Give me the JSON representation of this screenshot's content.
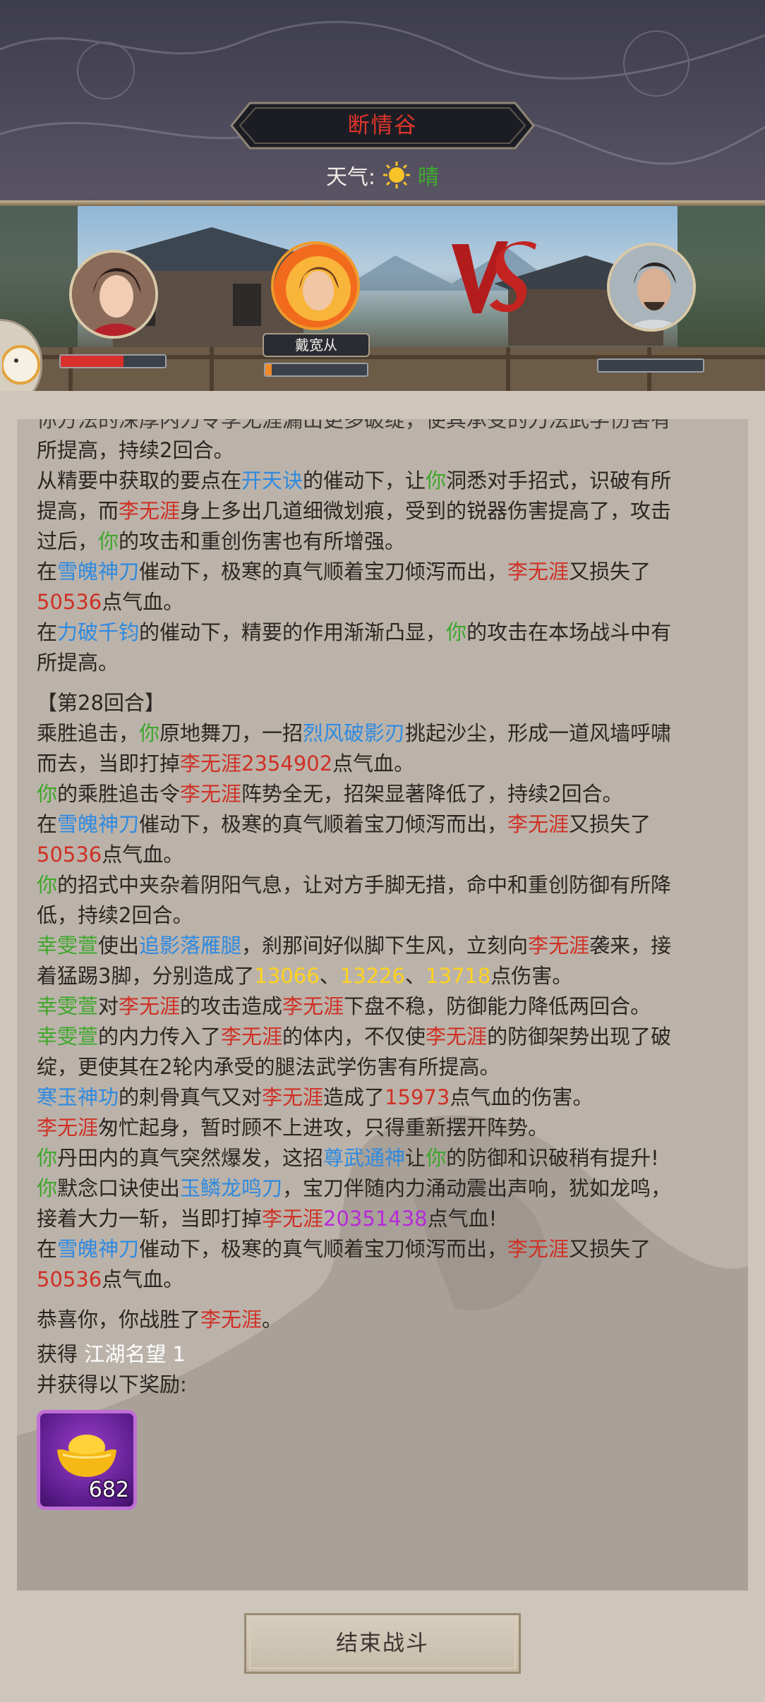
{
  "header": {
    "location": "断情谷",
    "weather_label": "天气:",
    "weather_value": "晴"
  },
  "battle": {
    "player_name_tag": "戴宽从",
    "player_hp_fraction": 0.6,
    "ally_hp_fraction": 0.06,
    "enemy_hp_fraction": 0.0
  },
  "log": {
    "l00": "你方法的深厚内力令李无涯漏出更多破绽，使其承受的刀法武学伤害有",
    "l01": "所提高，持续2回合。",
    "l02a": "从精要中获取的要点在",
    "l02b": "开天诀",
    "l02c": "的催动下，让",
    "l02d": "你",
    "l02e": "洞悉对手招式，识破有所",
    "l03a": "提高，而",
    "l03b": "李无涯",
    "l03c": "身上多出几道细微划痕，受到的锐器伤害提高了，攻击",
    "l04a": "过后，",
    "l04b": "你",
    "l04c": "的攻击和重创伤害也有所增强。",
    "l05a": "在",
    "l05b": "雪魄神刀",
    "l05c": "催动下，极寒的真气顺着宝刀倾泻而出，",
    "l05d": "李无涯",
    "l05e": "又损失了",
    "l06a": "50536",
    "l06b": "点气血。",
    "l07a": "在",
    "l07b": "力破千钧",
    "l07c": "的催动下，精要的作用渐渐凸显，",
    "l07d": "你",
    "l07e": "的攻击在本场战斗中有",
    "l08": "所提高。",
    "round": "【第28回合】",
    "l10a": "乘胜追击，",
    "l10b": "你",
    "l10c": "原地舞刀，一招",
    "l10d": "烈风破影刃",
    "l10e": "挑起沙尘，形成一道风墙呼啸",
    "l11a": "而去，当即打掉",
    "l11b": "李无涯2354902",
    "l11c": "点气血。",
    "l12a": "你",
    "l12b": "的乘胜追击令",
    "l12c": "李无涯",
    "l12d": "阵势全无，招架显著降低了，持续2回合。",
    "l13a": "在",
    "l13b": "雪魄神刀",
    "l13c": "催动下，极寒的真气顺着宝刀倾泻而出，",
    "l13d": "李无涯",
    "l13e": "又损失了",
    "l14a": "50536",
    "l14b": "点气血。",
    "l15a": "你",
    "l15b": "的招式中夹杂着阴阳气息，让对方手脚无措，命中和重创防御有所降",
    "l16": "低，持续2回合。",
    "l17a": "幸雯萱",
    "l17b": "使出",
    "l17c": "追影落雁腿",
    "l17d": "，刹那间好似脚下生风，立刻向",
    "l17e": "李无涯",
    "l17f": "袭来，接",
    "l18a": "着猛踢3脚，分别造成了",
    "l18b": "13066",
    "l18c": "、",
    "l18d": "13226",
    "l18e": "、",
    "l18f": "13718",
    "l18g": "点伤害。",
    "l19a": "幸雯萱",
    "l19b": "对",
    "l19c": "李无涯",
    "l19d": "的攻击造成",
    "l19e": "李无涯",
    "l19f": "下盘不稳，防御能力降低两回合。",
    "l20a": "幸雯萱",
    "l20b": "的内力传入了",
    "l20c": "李无涯",
    "l20d": "的体内，不仅使",
    "l20e": "李无涯",
    "l20f": "的防御架势出现了破",
    "l21": "绽，更使其在2轮内承受的腿法武学伤害有所提高。",
    "l22a": "寒玉神功",
    "l22b": "的刺骨真气又对",
    "l22c": "李无涯",
    "l22d": "造成了",
    "l22e": "15973",
    "l22f": "点气血的伤害。",
    "l23a": "李无涯",
    "l23b": "匆忙起身，暂时顾不上进攻，只得重新摆开阵势。",
    "l24a": "你",
    "l24b": "丹田内的真气突然爆发，这招",
    "l24c": "尊武通神",
    "l24d": "让",
    "l24e": "你",
    "l24f": "的防御和识破稍有提升!",
    "l25a": "你",
    "l25b": "默念口诀使出",
    "l25c": "玉鳞龙鸣刀",
    "l25d": "，宝刀伴随内力涌动震出声响，犹如龙鸣，",
    "l26a": "接着大力一斩，当即打掉",
    "l26b": "李无涯",
    "l26c": "20351438",
    "l26d": "点气血!",
    "l27a": "在",
    "l27b": "雪魄神刀",
    "l27c": "催动下，极寒的真气顺着宝刀倾泻而出，",
    "l27d": "李无涯",
    "l27e": "又损失了",
    "l28a": "50536",
    "l28b": "点气血。",
    "victory_a": "恭喜你，你战胜了",
    "victory_b": "李无涯",
    "victory_c": "。",
    "gain_a": "获得 ",
    "gain_b": "江湖名望 1",
    "reward_intro": "并获得以下奖励:"
  },
  "reward": {
    "icon": "gold-ingot-icon",
    "count": "682"
  },
  "end_button": "结束战斗"
}
